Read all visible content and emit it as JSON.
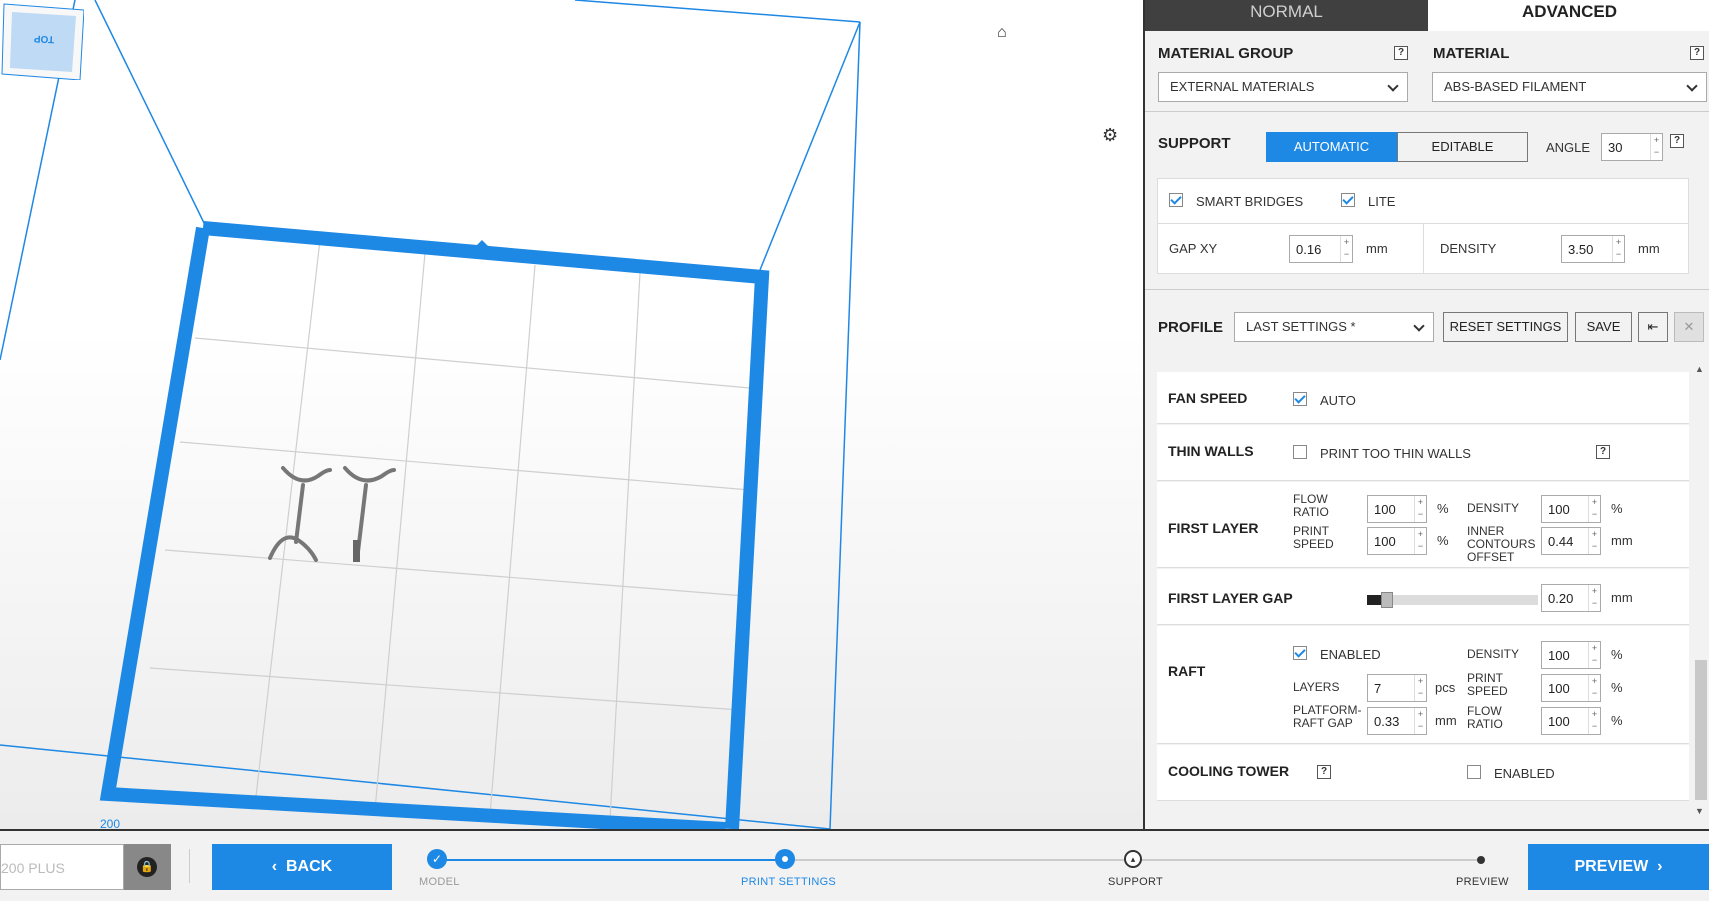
{
  "viewport": {
    "axis_label": "200",
    "viewcube_label": "TOP",
    "home_icon": "home-icon",
    "settings_icon": "gear-icon"
  },
  "tabs": {
    "normal": "NORMAL",
    "advanced": "ADVANCED"
  },
  "material": {
    "group_label": "MATERIAL GROUP",
    "group_value": "EXTERNAL MATERIALS",
    "material_label": "MATERIAL",
    "material_value": "ABS-BASED FILAMENT"
  },
  "support": {
    "label": "SUPPORT",
    "automatic": "AUTOMATIC",
    "editable": "EDITABLE",
    "angle_label": "ANGLE",
    "angle_value": "30",
    "smart_bridges": "SMART BRIDGES",
    "lite": "LITE",
    "gap_xy_label": "GAP XY",
    "gap_xy_value": "0.16",
    "gap_unit": "mm",
    "density_label": "DENSITY",
    "density_value": "3.50",
    "density_unit": "mm"
  },
  "profile": {
    "label": "PROFILE",
    "value": "LAST SETTINGS *",
    "reset": "RESET SETTINGS",
    "save": "SAVE"
  },
  "settings": {
    "fan_speed": {
      "label": "FAN SPEED",
      "auto": "AUTO"
    },
    "thin_walls": {
      "label": "THIN WALLS",
      "option": "PRINT TOO THIN WALLS"
    },
    "first_layer": {
      "label": "FIRST LAYER",
      "flow_ratio_label": "FLOW RATIO",
      "flow_ratio": "100",
      "print_speed_label": "PRINT SPEED",
      "print_speed": "100",
      "density_label": "DENSITY",
      "density": "100",
      "inner_contours_label": "INNER CONTOURS OFFSET",
      "inner_contours": "0.44",
      "pct": "%",
      "mm": "mm"
    },
    "first_layer_gap": {
      "label": "FIRST LAYER GAP",
      "value": "0.20",
      "unit": "mm",
      "slider_fraction": 0.1
    },
    "raft": {
      "label": "RAFT",
      "enabled": "ENABLED",
      "layers_label": "LAYERS",
      "layers": "7",
      "layers_unit": "pcs",
      "gap_label": "PLATFORM-RAFT GAP",
      "gap": "0.33",
      "gap_unit": "mm",
      "density_label": "DENSITY",
      "density": "100",
      "print_speed_label": "PRINT SPEED",
      "print_speed": "100",
      "flow_ratio_label": "FLOW RATIO",
      "flow_ratio": "100",
      "pct": "%"
    },
    "cooling_tower": {
      "label": "COOLING TOWER",
      "enabled": "ENABLED"
    }
  },
  "bottom": {
    "printer": "200 PLUS",
    "back": "BACK",
    "steps": [
      "MODEL",
      "PRINT SETTINGS",
      "SUPPORT",
      "PREVIEW"
    ],
    "preview": "PREVIEW"
  },
  "colors": {
    "accent": "#1e88e5",
    "dark": "#404040"
  }
}
